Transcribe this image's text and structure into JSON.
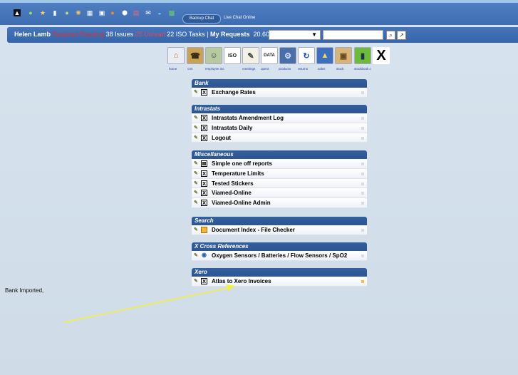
{
  "topbar": {
    "backup_chat": "Backup Chat",
    "live_chat": "Live Chat Online"
  },
  "status": {
    "user": "Helen Lamb",
    "required_reading": "Required Reading",
    "issues": "38 Issues",
    "unread_count": "25",
    "unread_label": "Unread",
    "iso_tasks": "22 ISO Tasks |",
    "my_requests": "My Requests",
    "temperature": "20.60 °C"
  },
  "nav": [
    {
      "label": "home"
    },
    {
      "label": "crm"
    },
    {
      "label": "employee iso"
    },
    {
      "label": "meetings"
    },
    {
      "label": "opera"
    },
    {
      "label": "products"
    },
    {
      "label": "returns"
    },
    {
      "label": "sales"
    },
    {
      "label": "stock"
    },
    {
      "label": "stockbook c"
    },
    {
      "label": ""
    }
  ],
  "groups": [
    {
      "title": "Bank",
      "items": [
        {
          "label": "Exchange Rates"
        }
      ]
    },
    {
      "title": "Intrastats",
      "items": [
        {
          "label": "Intrastats Amendment Log"
        },
        {
          "label": "Intrastats Daily"
        },
        {
          "label": "Logout"
        }
      ]
    },
    {
      "title": "Miscellaneous",
      "items": [
        {
          "label": "Simple one off reports"
        },
        {
          "label": "Temperature Limits"
        },
        {
          "label": "Tested Stickers"
        },
        {
          "label": "Viamed-Online"
        },
        {
          "label": "Viamed-Online Admin"
        }
      ]
    },
    {
      "title": "Search",
      "items": [
        {
          "label": "Document Index - File Checker"
        }
      ]
    },
    {
      "title": "X Cross References",
      "items": [
        {
          "label": "Oxygen Sensors / Batteries / Flow Sensors / SpO2"
        }
      ]
    },
    {
      "title": "Xero",
      "items": [
        {
          "label": "Atlas to Xero Invoices"
        }
      ]
    }
  ],
  "bank_imported": "Bank Imported,",
  "colors": {
    "header": "#3e6db3",
    "group_header": "#2c5591",
    "annotation": "#f5f03a"
  }
}
